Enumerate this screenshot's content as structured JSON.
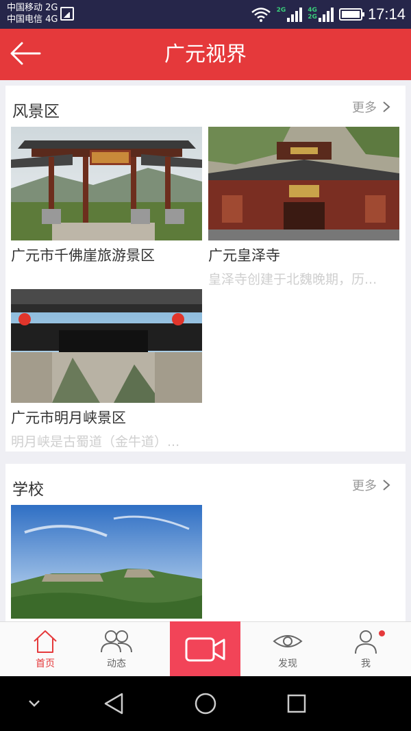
{
  "status": {
    "carrier1": "中国移动 2G",
    "carrier2": "中国电信 4G",
    "net_a": "2G",
    "net_b1": "4G",
    "net_b2": "2G",
    "time": "17:14"
  },
  "header": {
    "title": "广元视界"
  },
  "sections": [
    {
      "title": "风景区",
      "more": "更多",
      "cards": [
        {
          "title": "广元市千佛崖旅游景区",
          "desc": ""
        },
        {
          "title": "广元皇泽寺",
          "desc": "皇泽寺创建于北魏晚期，历..."
        },
        {
          "title": "广元市明月峡景区",
          "desc": "明月峡是古蜀道（金牛道）..."
        }
      ]
    },
    {
      "title": "学校",
      "more": "更多",
      "cards": []
    }
  ],
  "tabs": [
    {
      "label": "首页",
      "icon": "home-icon",
      "active": true
    },
    {
      "label": "动态",
      "icon": "people-icon",
      "active": false
    },
    {
      "label": "",
      "icon": "video-camera-icon",
      "active": false
    },
    {
      "label": "发现",
      "icon": "eye-icon",
      "active": false
    },
    {
      "label": "我",
      "icon": "user-icon",
      "active": false
    }
  ],
  "colors": {
    "accent": "#e5393b",
    "record": "#f24458",
    "statusbar": "#26264a"
  }
}
